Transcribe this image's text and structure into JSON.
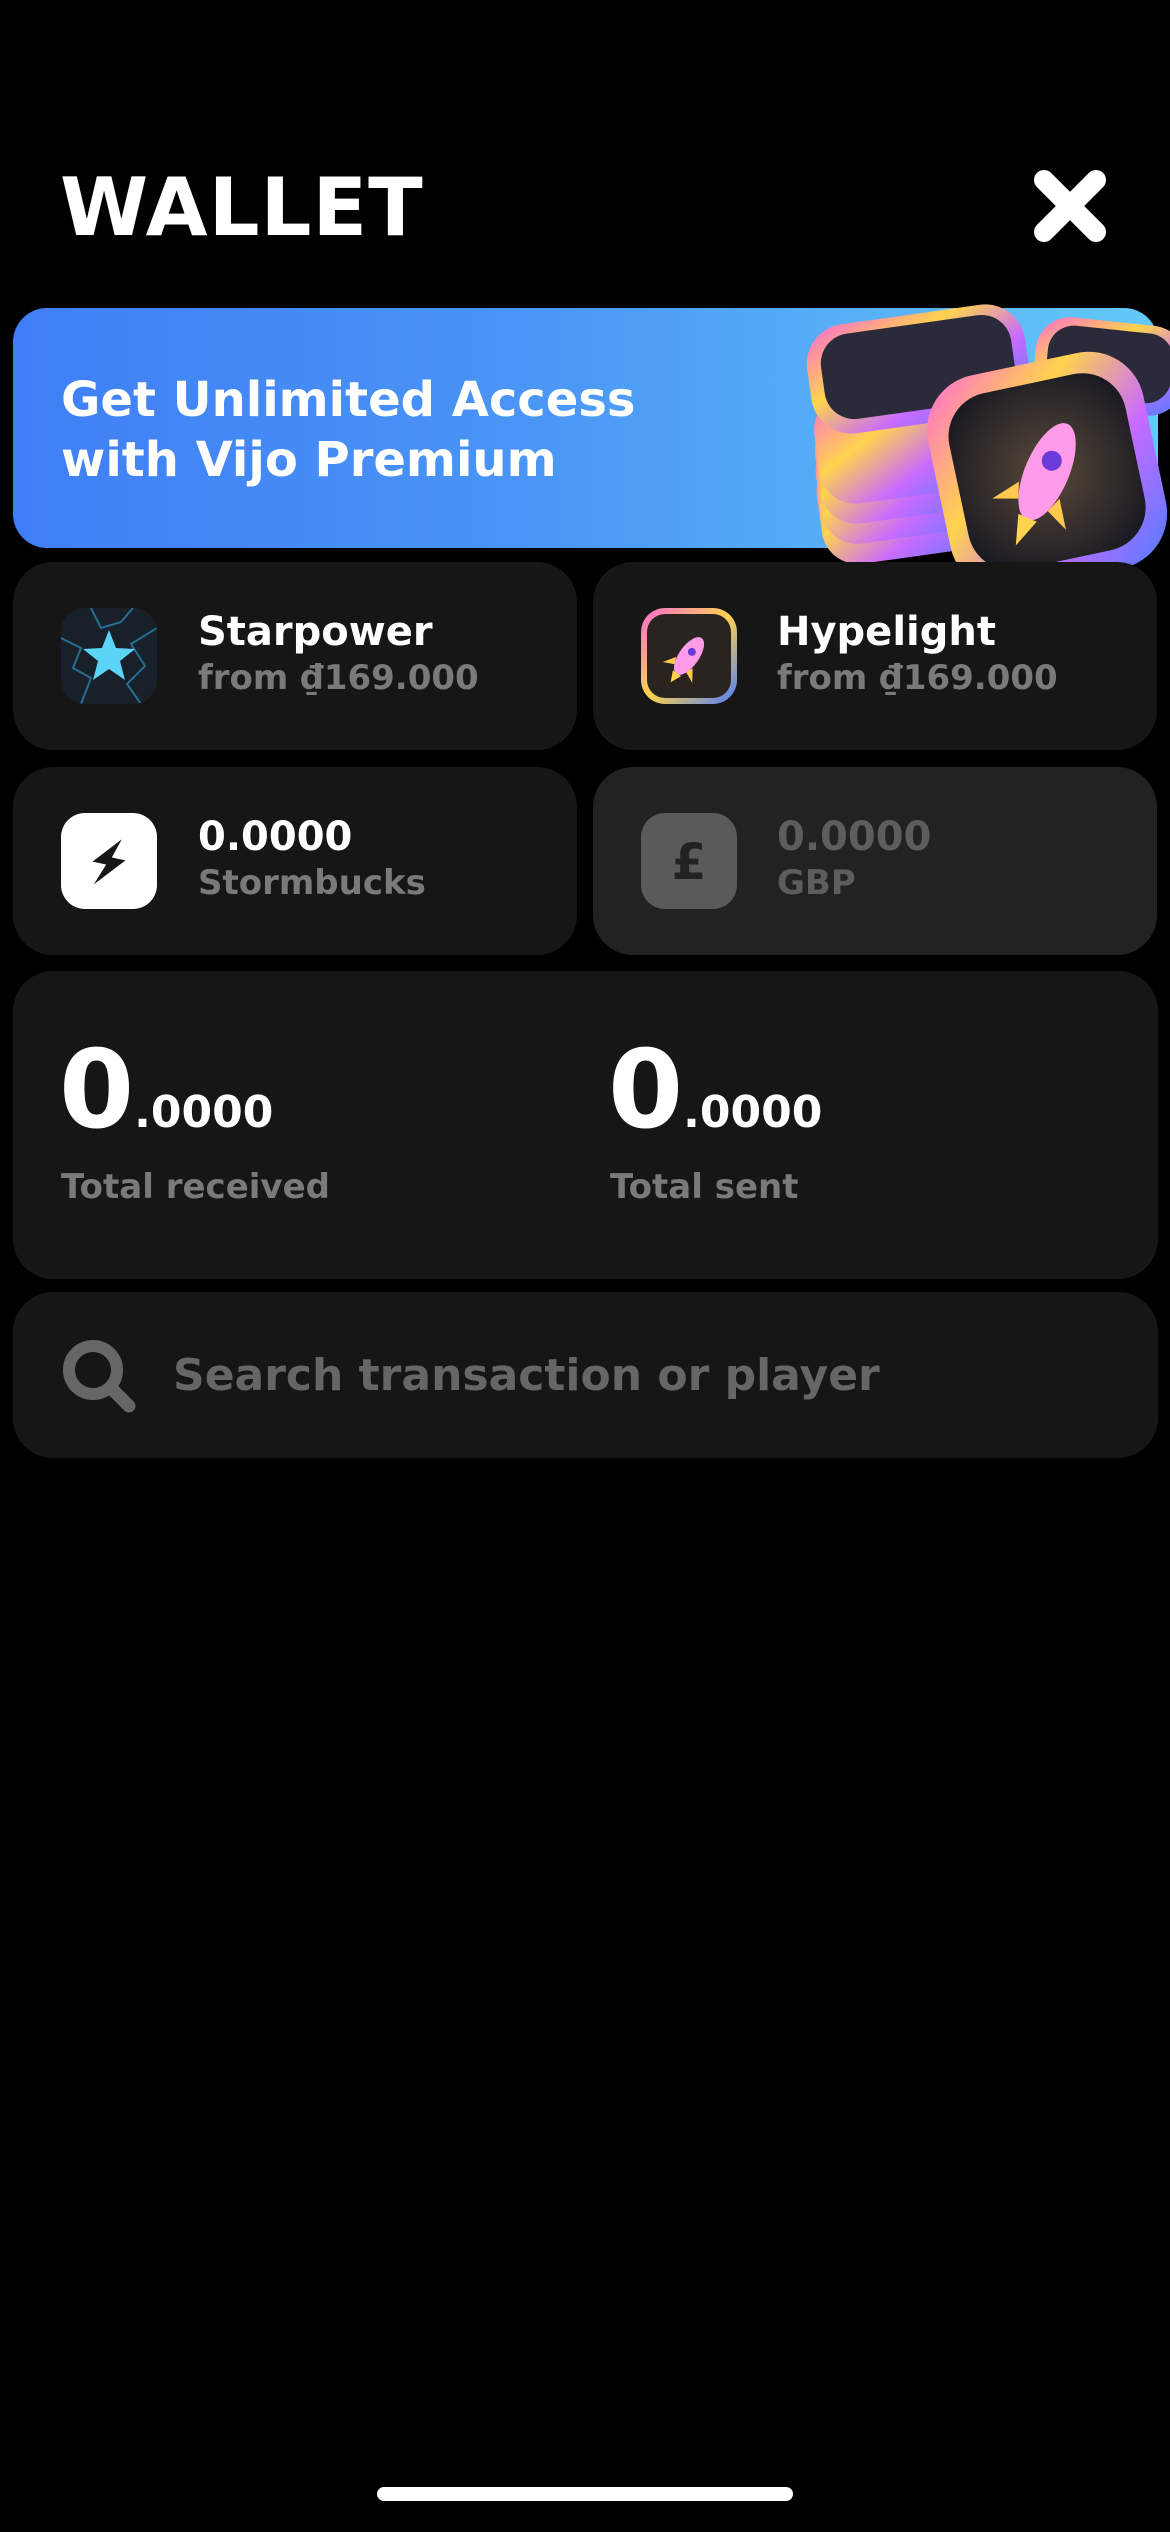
{
  "header": {
    "title": "WALLET"
  },
  "promo": {
    "text": "Get Unlimited Access with Vijo Premium"
  },
  "products": [
    {
      "name": "Starpower",
      "price": "from ₫169.000",
      "icon": "star-icon"
    },
    {
      "name": "Hypelight",
      "price": "from ₫169.000",
      "icon": "rocket-icon"
    }
  ],
  "balances": [
    {
      "amount": "0.0000",
      "currency": "Stormbucks",
      "icon": "lightning-icon"
    },
    {
      "amount": "0.0000",
      "currency": "GBP",
      "icon": "pound-icon"
    }
  ],
  "totals": [
    {
      "int": "0",
      "dec": ".0000",
      "label": "Total received"
    },
    {
      "int": "0",
      "dec": ".0000",
      "label": "Total sent"
    }
  ],
  "search": {
    "placeholder": "Search transaction or player"
  },
  "colors": {
    "promo_start": "#3f7ef5",
    "promo_end": "#63c9f8",
    "card": "#161616",
    "muted": "#7a7a7a"
  }
}
